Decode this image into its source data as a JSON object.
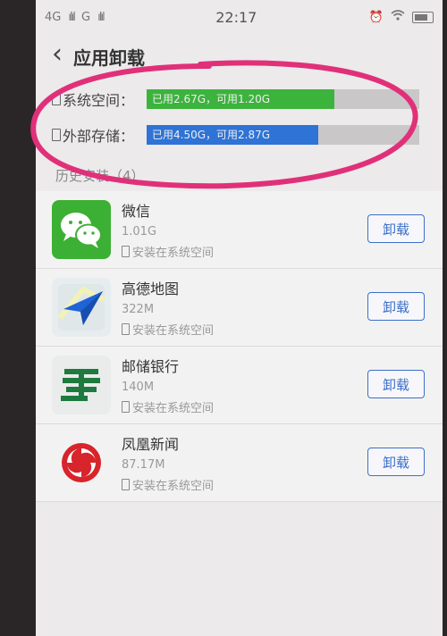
{
  "status": {
    "signal1": "4G",
    "signal2": "G",
    "time": "22:17"
  },
  "header": {
    "title": "应用卸载"
  },
  "storage": {
    "system": {
      "label": "系统空间：",
      "bar_text": "已用2.67G，可用1.20G",
      "used_fraction": 0.69,
      "color": "#3cb33c"
    },
    "external": {
      "label": "外部存储：",
      "bar_text": "已用4.50G，可用2.87G",
      "used_fraction": 0.63,
      "color": "#2f73d6"
    }
  },
  "section": {
    "title": "历史安装（4）"
  },
  "apps": [
    {
      "name": "微信",
      "size": "1.01G",
      "location": "安装在系统空间",
      "button": "卸载",
      "icon": "wechat-icon"
    },
    {
      "name": "高德地图",
      "size": "322M",
      "location": "安装在系统空间",
      "button": "卸载",
      "icon": "amap-icon"
    },
    {
      "name": "邮储银行",
      "size": "140M",
      "location": "安装在系统空间",
      "button": "卸载",
      "icon": "psbc-icon"
    },
    {
      "name": "凤凰新闻",
      "size": "87.17M",
      "location": "安装在系统空间",
      "button": "卸载",
      "icon": "ifeng-icon"
    }
  ],
  "colors": {
    "accent": "#3b6fc8",
    "annotation": "#e0307a"
  }
}
